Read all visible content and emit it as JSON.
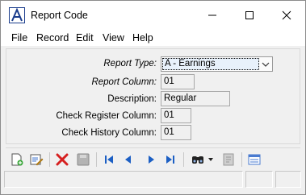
{
  "window": {
    "title": "Report Code",
    "controls": [
      "minimize-icon",
      "maximize-icon",
      "close-icon"
    ]
  },
  "menu": {
    "items": [
      "File",
      "Record",
      "Edit",
      "View",
      "Help"
    ]
  },
  "form": {
    "report_type_label": "Report Type:",
    "report_type_value": "A - Earnings",
    "report_column_label": "Report Column:",
    "report_column_value": "01",
    "description_label": "Description:",
    "description_value": "Regular",
    "check_register_label": "Check Register Column:",
    "check_register_value": "01",
    "check_history_label": "Check History Column:",
    "check_history_value": "01"
  },
  "toolbar": {
    "icons": [
      "new-record-icon",
      "edit-record-icon",
      "delete-icon",
      "save-icon",
      "first-record-icon",
      "previous-record-icon",
      "next-record-icon",
      "last-record-icon",
      "find-icon",
      "find-dropdown-icon",
      "report-icon",
      "list-view-icon"
    ]
  },
  "colors": {
    "accent_blue": "#1c5fc4",
    "delete_red": "#d62020",
    "window_bg": "#f0f0f0"
  }
}
